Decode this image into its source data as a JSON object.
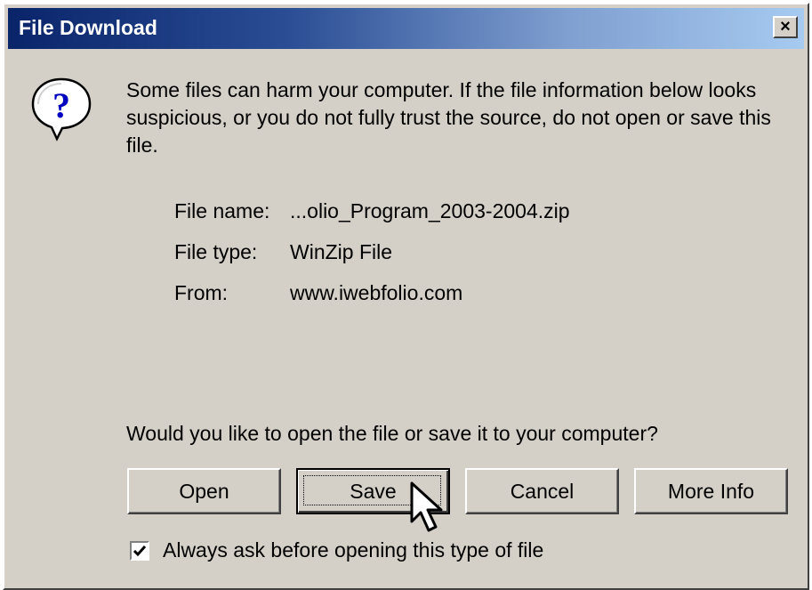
{
  "dialog": {
    "title": "File Download",
    "close_label": "×",
    "warning_text": "Some files can harm your computer. If the file information below looks suspicious, or you do not fully trust the source, do not open or save this file.",
    "file_info": [
      {
        "label": "File name:",
        "value": "...olio_Program_2003-2004.zip"
      },
      {
        "label": "File type:",
        "value": "WinZip File"
      },
      {
        "label": "From:",
        "value": "www.iwebfolio.com"
      }
    ],
    "question": "Would you like to open the file or save it to your computer?",
    "buttons": {
      "open": "Open",
      "save": "Save",
      "cancel": "Cancel",
      "more_info": "More Info"
    },
    "checkbox": {
      "label": "Always ask before opening this type of file",
      "checked": true
    },
    "icon": "question-balloon-icon",
    "colors": {
      "face": "#d4d0c8",
      "title_gradient_start": "#0a246a",
      "title_gradient_end": "#a6caf0"
    }
  }
}
